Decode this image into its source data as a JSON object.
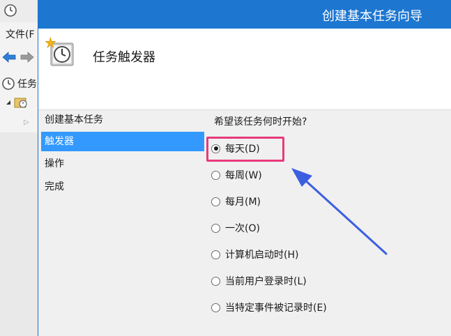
{
  "background_window": {
    "menu_label": "文件(F",
    "tree_root_label": "任务"
  },
  "dialog": {
    "title": "创建基本任务向导",
    "header_title": "任务触发器"
  },
  "nav": {
    "items": [
      {
        "label": "创建基本任务",
        "selected": false
      },
      {
        "label": "触发器",
        "selected": true
      },
      {
        "label": "操作",
        "selected": false
      },
      {
        "label": "完成",
        "selected": false
      }
    ]
  },
  "trigger": {
    "question": "希望该任务何时开始?",
    "options": [
      {
        "label": "每天(D)",
        "checked": true
      },
      {
        "label": "每周(W)",
        "checked": false
      },
      {
        "label": "每月(M)",
        "checked": false
      },
      {
        "label": "一次(O)",
        "checked": false
      },
      {
        "label": "计算机启动时(H)",
        "checked": false
      },
      {
        "label": "当前用户登录时(L)",
        "checked": false
      },
      {
        "label": "当特定事件被记录时(E)",
        "checked": false
      }
    ]
  },
  "colors": {
    "titlebar": "#1d77d1",
    "nav_selected": "#3399ff",
    "highlight_box": "#e83a7a",
    "annotation_arrow": "#3c5fe0"
  },
  "icons": {
    "app": "clock-icon",
    "back": "back-arrow-icon",
    "forward": "forward-arrow-icon",
    "header": "scheduled-task-clock-icon"
  }
}
